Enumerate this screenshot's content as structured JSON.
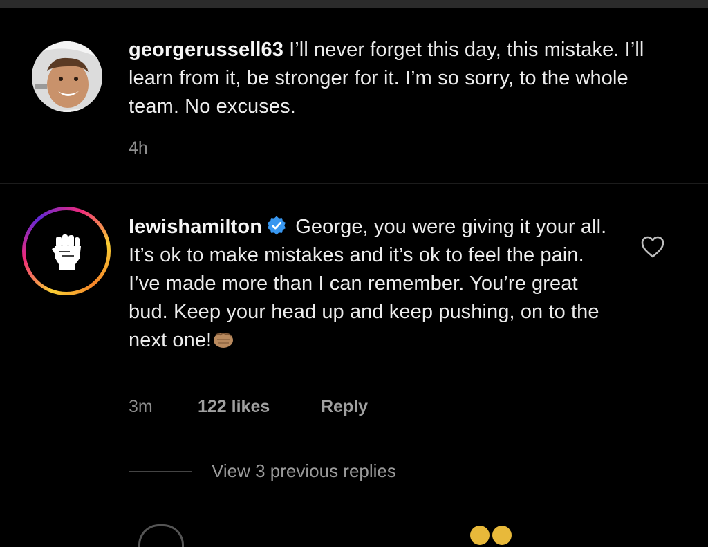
{
  "comments": [
    {
      "username": "georgerussell63",
      "text": "I’ll never forget this day, this mistake. I’ll learn from it, be stronger for it. I’m so sorry, to the whole team. No excuses.",
      "time": "4h"
    },
    {
      "username": "lewishamilton",
      "verified": true,
      "text": "George, you were giving it your all. It’s ok to make mistakes and it’s ok to feel the pain. I’ve made more than I can remember. You’re great bud. Keep your head up and keep pushing, on to the next one!",
      "emoji": "fist-bump-emoji",
      "time": "3m",
      "likes": "122 likes",
      "reply_label": "Reply",
      "view_replies": "View 3 previous replies"
    }
  ],
  "icons": {
    "verified": "verified-badge-icon",
    "like": "heart-outline-icon",
    "avatar_lewis": "raised-fist-icon"
  },
  "colors": {
    "background": "#000000",
    "text": "#ececec",
    "meta": "#8e8e8e",
    "verified": "#3897f0"
  }
}
